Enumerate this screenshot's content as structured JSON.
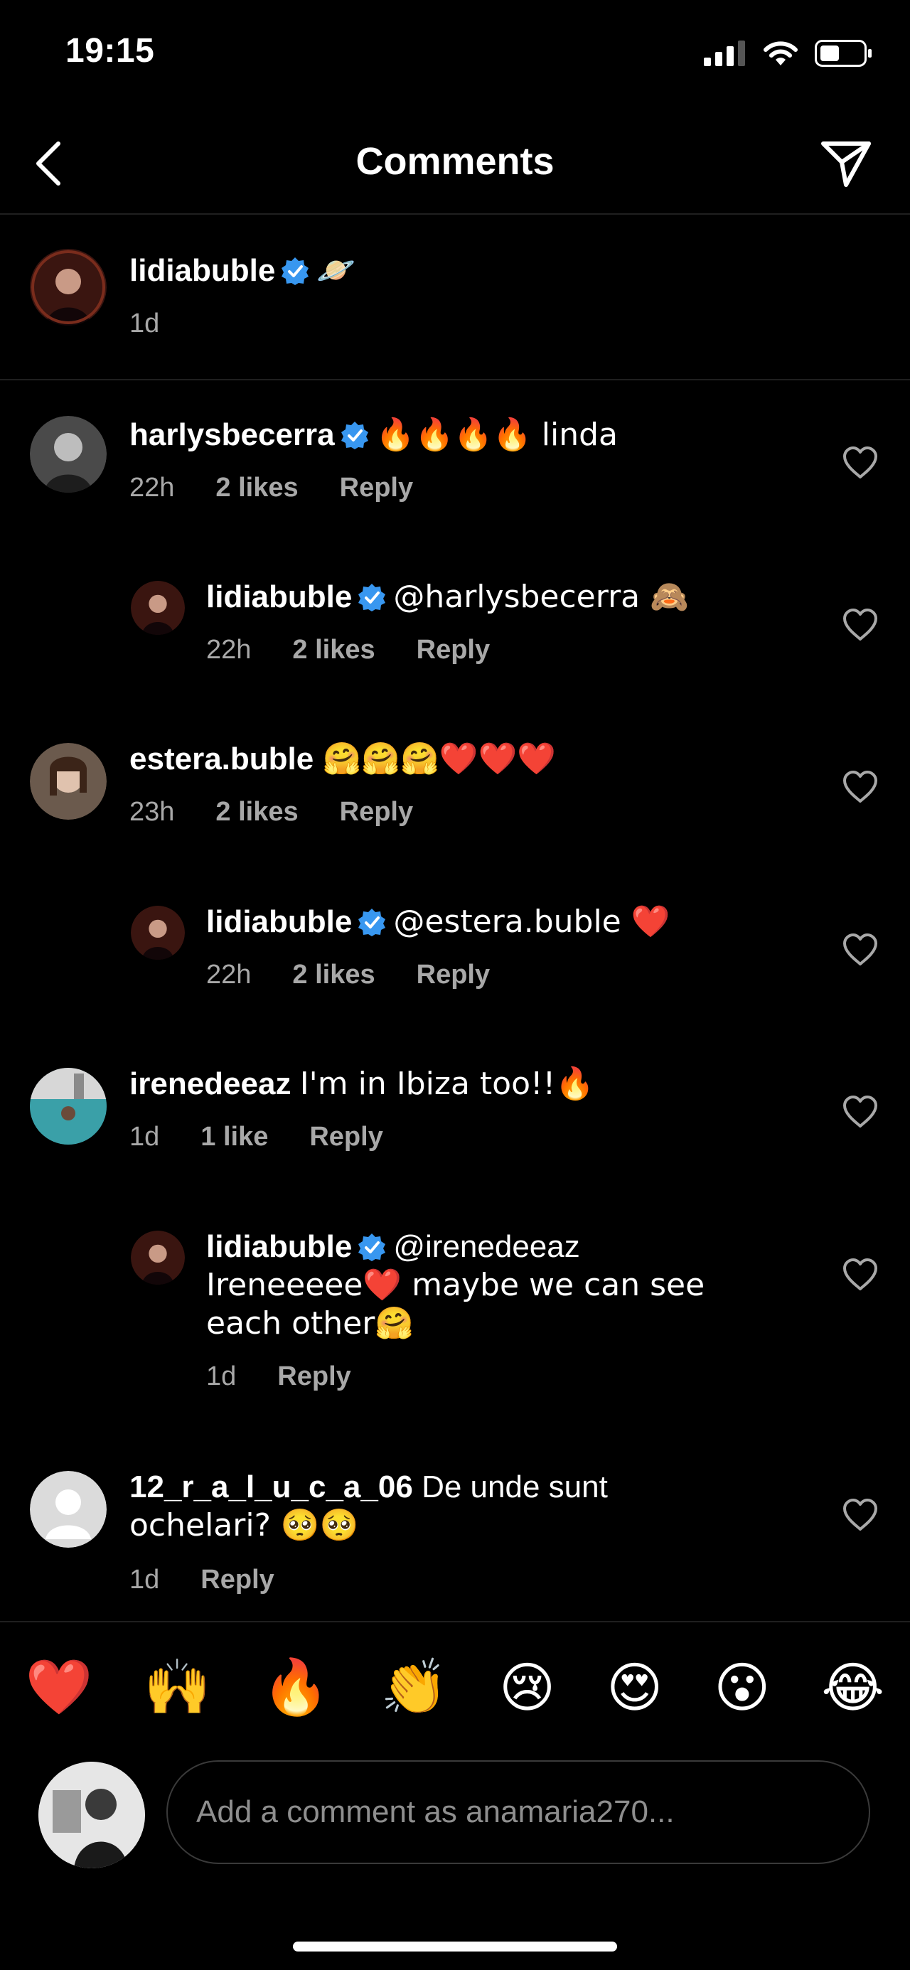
{
  "status": {
    "time": "19:15"
  },
  "header": {
    "title": "Comments"
  },
  "caption": {
    "username": "lidiabuble",
    "emoji": "🪐",
    "time": "1d"
  },
  "comments": [
    {
      "username": "harlysbecerra",
      "verified": true,
      "text": "🔥🔥🔥🔥 linda",
      "time": "22h",
      "likes": "2 likes",
      "reply": "Reply"
    },
    {
      "username": "lidiabuble",
      "verified": true,
      "text": "@harlysbecerra 🙈",
      "time": "22h",
      "likes": "2 likes",
      "reply": "Reply"
    },
    {
      "username": "estera.buble",
      "verified": false,
      "text": "🤗🤗🤗❤️❤️❤️",
      "time": "23h",
      "likes": "2 likes",
      "reply": "Reply"
    },
    {
      "username": "lidiabuble",
      "verified": true,
      "text": "@estera.buble ❤️",
      "time": "22h",
      "likes": "2 likes",
      "reply": "Reply"
    },
    {
      "username": "irenedeeaz",
      "verified": false,
      "text": "I'm in Ibiza too!!🔥",
      "time": "1d",
      "likes": "1 like",
      "reply": "Reply"
    },
    {
      "username": "lidiabuble",
      "verified": true,
      "line1": "@irenedeeaz",
      "line2": "Ireneeeee❤️ maybe we can see",
      "line3": "each other🤗",
      "time": "1d",
      "reply": "Reply"
    },
    {
      "username": "12_r_a_l_u_c_a_06",
      "verified": false,
      "line1": "De unde sunt",
      "line2": "ochelari? 🥺🥺",
      "time": "1d",
      "reply": "Reply"
    }
  ],
  "quick_emojis": [
    "❤️",
    "🙌",
    "🔥",
    "👏",
    "😢",
    "😍",
    "😮",
    "😂"
  ],
  "composer": {
    "placeholder": "Add a comment as anamaria270..."
  },
  "colors": {
    "background": "#000000",
    "verified": "#3897f0",
    "meta": "#a8a8a8"
  }
}
